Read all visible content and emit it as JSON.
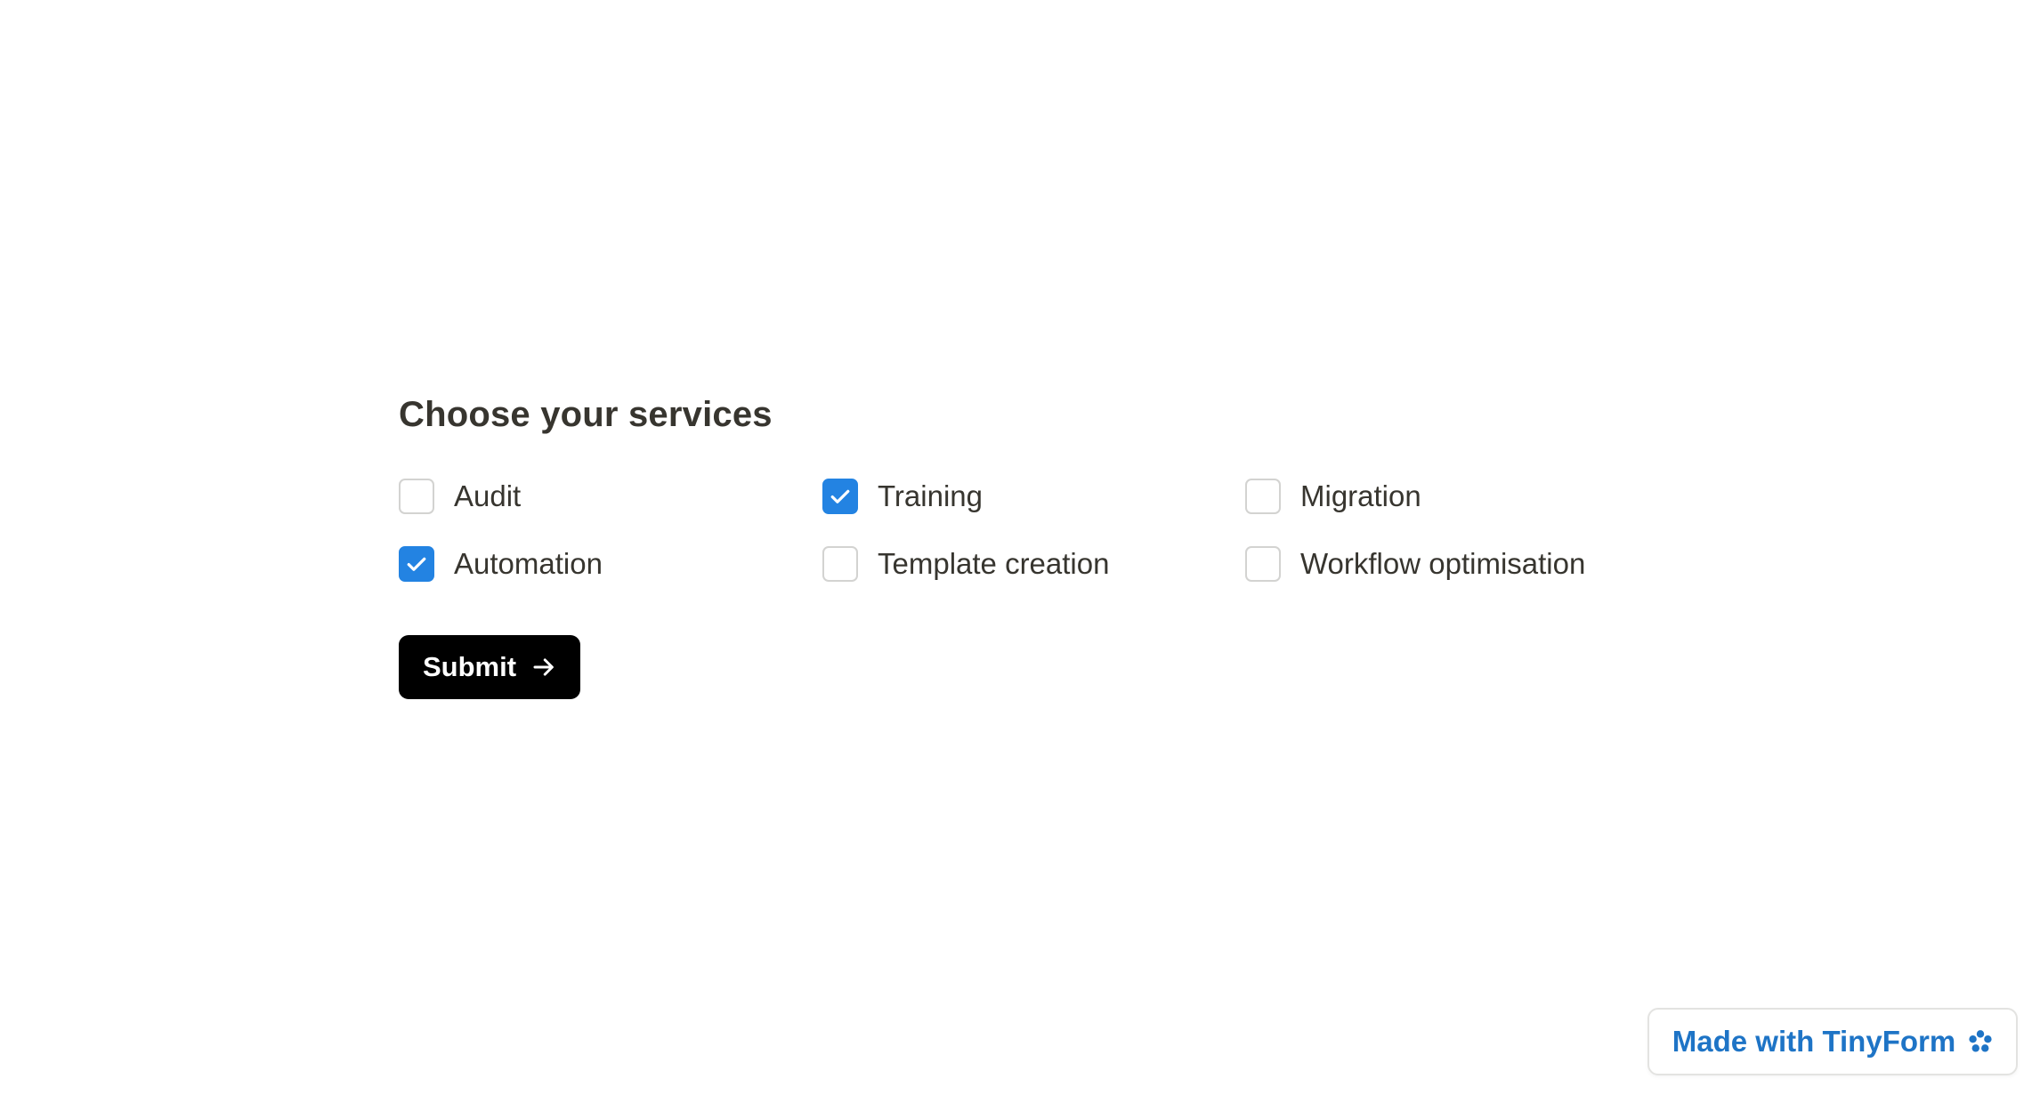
{
  "form": {
    "title": "Choose your services",
    "options": [
      {
        "label": "Audit",
        "checked": false
      },
      {
        "label": "Training",
        "checked": true
      },
      {
        "label": "Migration",
        "checked": false
      },
      {
        "label": "Automation",
        "checked": true
      },
      {
        "label": "Template creation",
        "checked": false
      },
      {
        "label": "Workflow optimisation",
        "checked": false
      }
    ],
    "submit_label": "Submit",
    "submit_icon": "arrow-right-icon"
  },
  "badge": {
    "label": "Made with TinyForm",
    "icon": "tinyform-flower-icon"
  },
  "colors": {
    "accent": "#2383e2",
    "text": "#37352f",
    "button": "#000000",
    "badge_text": "#1e74c6"
  }
}
